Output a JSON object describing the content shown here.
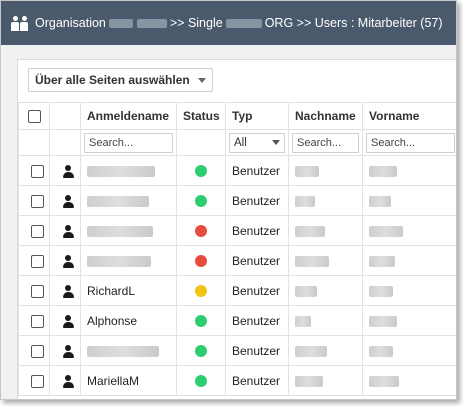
{
  "title": {
    "prefix": "Organisation",
    "middle": ">> Single",
    "suffix": "ORG >> Users : Mitarbeiter (57)"
  },
  "colors": {
    "titlebar": "#4a5a6c",
    "status_active": "#2ecc71",
    "status_inactive": "#e74c3c",
    "status_pending": "#f1c40f"
  },
  "toolbar": {
    "select_all_label": "Über alle Seiten auswählen"
  },
  "columns": {
    "username": "Anmeldename",
    "status": "Status",
    "type": "Typ",
    "lastname": "Nachname",
    "firstname": "Vorname"
  },
  "filters": {
    "username_placeholder": "Search...",
    "type_value": "All",
    "lastname_placeholder": "Search...",
    "firstname_placeholder": "Search..."
  },
  "rows": [
    {
      "username": "",
      "status": "active",
      "type": "Benutzer"
    },
    {
      "username": "",
      "status": "active",
      "type": "Benutzer"
    },
    {
      "username": "",
      "status": "inactive",
      "type": "Benutzer"
    },
    {
      "username": "",
      "status": "inactive",
      "type": "Benutzer"
    },
    {
      "username": "RichardL",
      "status": "pending",
      "type": "Benutzer"
    },
    {
      "username": "Alphonse",
      "status": "active",
      "type": "Benutzer"
    },
    {
      "username": "",
      "status": "active",
      "type": "Benutzer"
    },
    {
      "username": "MariellaM",
      "status": "active",
      "type": "Benutzer"
    }
  ]
}
